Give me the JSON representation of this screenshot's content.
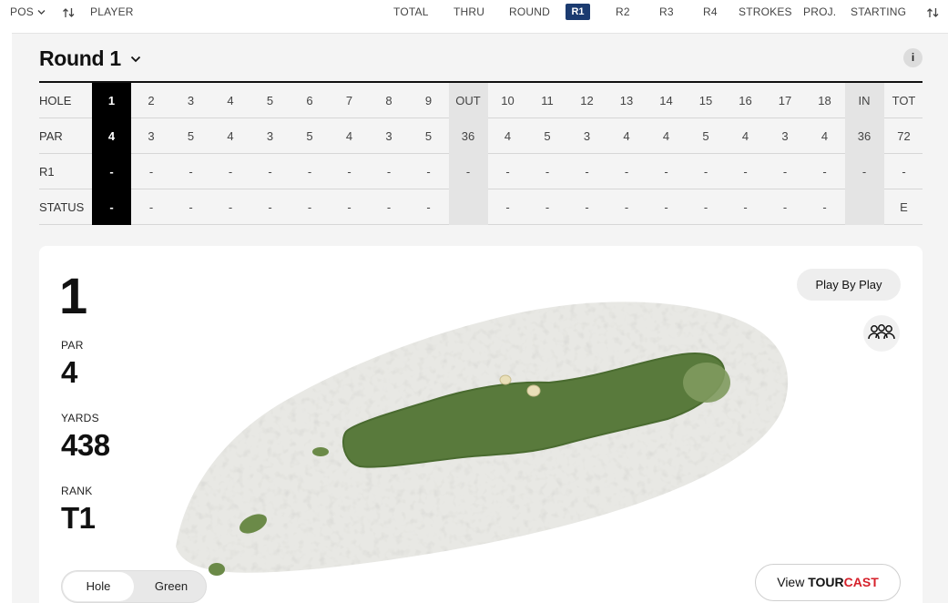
{
  "header": {
    "pos_label": "POS",
    "player_label": "PLAYER",
    "columns": [
      "TOTAL",
      "THRU",
      "ROUND",
      "R1",
      "R2",
      "R3",
      "R4",
      "STROKES",
      "PROJ.",
      "STARTING"
    ],
    "active_round": "R1"
  },
  "round_selector": {
    "label": "Round 1"
  },
  "info": {
    "label": "i"
  },
  "scorecard": {
    "labels": {
      "hole": "HOLE",
      "par": "PAR",
      "round": "R1",
      "status": "STATUS"
    },
    "holes": [
      "1",
      "2",
      "3",
      "4",
      "5",
      "6",
      "7",
      "8",
      "9",
      "OUT",
      "10",
      "11",
      "12",
      "13",
      "14",
      "15",
      "16",
      "17",
      "18",
      "IN",
      "TOT"
    ],
    "par": [
      "4",
      "3",
      "5",
      "4",
      "3",
      "5",
      "4",
      "3",
      "5",
      "36",
      "4",
      "5",
      "3",
      "4",
      "4",
      "5",
      "4",
      "3",
      "4",
      "36",
      "72"
    ],
    "r1": [
      "-",
      "-",
      "-",
      "-",
      "-",
      "-",
      "-",
      "-",
      "-",
      "-",
      "-",
      "-",
      "-",
      "-",
      "-",
      "-",
      "-",
      "-",
      "-",
      "-",
      "-"
    ],
    "status": [
      "-",
      "-",
      "-",
      "-",
      "-",
      "-",
      "-",
      "-",
      "-",
      "",
      "-",
      "-",
      "-",
      "-",
      "-",
      "-",
      "-",
      "-",
      "-",
      "",
      "E"
    ]
  },
  "hole_detail": {
    "number": "1",
    "par_label": "PAR",
    "par_value": "4",
    "yards_label": "YARDS",
    "yards_value": "438",
    "rank_label": "RANK",
    "rank_value": "T1"
  },
  "buttons": {
    "play_by_play": "Play By Play",
    "view_prefix": "View ",
    "tour": "TOUR",
    "cast": "CAST"
  },
  "view_toggle": {
    "hole": "Hole",
    "green": "Green",
    "selected": "Hole"
  },
  "colors": {
    "active_pill": "#1b3b70",
    "fairway": "#5a7a3a",
    "rough": "#e6e6e2",
    "brand_red": "#d6202a"
  },
  "icons": [
    "chevron-down-icon",
    "sort-arrows-icon",
    "info-icon",
    "group-icon"
  ]
}
